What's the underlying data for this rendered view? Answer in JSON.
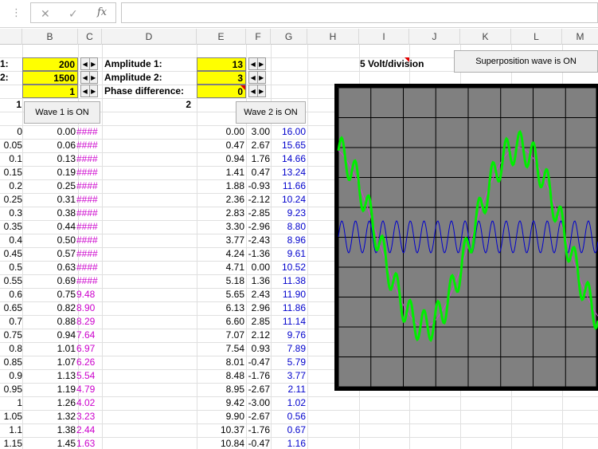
{
  "formula_bar": {
    "dots": "⋮",
    "cancel": "✕",
    "enter": "✓",
    "fx": "fx",
    "value": ""
  },
  "columns": [
    "B",
    "C",
    "D",
    "E",
    "F",
    "G",
    "H",
    "I",
    "J",
    "K",
    "L",
    "M"
  ],
  "controls": {
    "label_a1": "1:",
    "label_a2": "2:",
    "freq1": "200",
    "freq2": "1500",
    "freq3": "1",
    "amp1_label": "Amplitude 1:",
    "amp2_label": "Amplitude 2:",
    "phase_label": "Phase difference:",
    "amp1": "13",
    "amp2": "3",
    "phase": "0",
    "scale_label": "5 Volt/division",
    "superposition_button": "Superposition wave is ON",
    "wave1_button": "Wave 1 is ON",
    "wave2_button": "Wave 2 is ON",
    "header_a": "1",
    "header_d": "2"
  },
  "table": {
    "rows": [
      [
        "0",
        "0.00",
        "####",
        "0.00",
        "3.00",
        "16.00"
      ],
      [
        "0.05",
        "0.06",
        "####",
        "0.47",
        "2.67",
        "15.65"
      ],
      [
        "0.1",
        "0.13",
        "####",
        "0.94",
        "1.76",
        "14.66"
      ],
      [
        "0.15",
        "0.19",
        "####",
        "1.41",
        "0.47",
        "13.24"
      ],
      [
        "0.2",
        "0.25",
        "####",
        "1.88",
        "-0.93",
        "11.66"
      ],
      [
        "0.25",
        "0.31",
        "####",
        "2.36",
        "-2.12",
        "10.24"
      ],
      [
        "0.3",
        "0.38",
        "####",
        "2.83",
        "-2.85",
        "9.23"
      ],
      [
        "0.35",
        "0.44",
        "####",
        "3.30",
        "-2.96",
        "8.80"
      ],
      [
        "0.4",
        "0.50",
        "####",
        "3.77",
        "-2.43",
        "8.96"
      ],
      [
        "0.45",
        "0.57",
        "####",
        "4.24",
        "-1.36",
        "9.61"
      ],
      [
        "0.5",
        "0.63",
        "####",
        "4.71",
        "0.00",
        "10.52"
      ],
      [
        "0.55",
        "0.69",
        "####",
        "5.18",
        "1.36",
        "11.38"
      ],
      [
        "0.6",
        "0.75",
        "9.48",
        "5.65",
        "2.43",
        "11.90"
      ],
      [
        "0.65",
        "0.82",
        "8.90",
        "6.13",
        "2.96",
        "11.86"
      ],
      [
        "0.7",
        "0.88",
        "8.29",
        "6.60",
        "2.85",
        "11.14"
      ],
      [
        "0.75",
        "0.94",
        "7.64",
        "7.07",
        "2.12",
        "9.76"
      ],
      [
        "0.8",
        "1.01",
        "6.97",
        "7.54",
        "0.93",
        "7.89"
      ],
      [
        "0.85",
        "1.07",
        "6.26",
        "8.01",
        "-0.47",
        "5.79"
      ],
      [
        "0.9",
        "1.13",
        "5.54",
        "8.48",
        "-1.76",
        "3.77"
      ],
      [
        "0.95",
        "1.19",
        "4.79",
        "8.95",
        "-2.67",
        "2.11"
      ],
      [
        "1",
        "1.26",
        "4.02",
        "9.42",
        "-3.00",
        "1.02"
      ],
      [
        "1.05",
        "1.32",
        "3.23",
        "9.90",
        "-2.67",
        "0.56"
      ],
      [
        "1.1",
        "1.38",
        "2.44",
        "10.37",
        "-1.76",
        "0.67"
      ],
      [
        "1.15",
        "1.45",
        "1.63",
        "10.84",
        "-0.47",
        "1.16"
      ]
    ]
  },
  "colors": {
    "scope_bg": "#808080",
    "wave_sum": "#00ee00",
    "wave1": "#cc44cc",
    "wave2": "#0000cc",
    "highlight": "#ffff00"
  }
}
